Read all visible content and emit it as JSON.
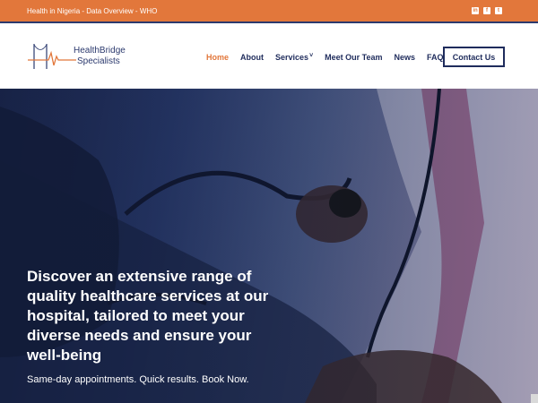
{
  "topbar": {
    "link_text": "Health in Nigeria - Data Overview - WHO",
    "socials": [
      {
        "icon": "linkedin-icon",
        "glyph": "in"
      },
      {
        "icon": "facebook-icon",
        "glyph": "f"
      },
      {
        "icon": "twitter-icon",
        "glyph": "t"
      }
    ]
  },
  "brand": {
    "line1": "HealthBridge",
    "line2": "Specialists"
  },
  "nav": {
    "items": [
      {
        "label": "Home",
        "active": true
      },
      {
        "label": "About"
      },
      {
        "label": "Services",
        "has_dropdown": true
      },
      {
        "label": "Meet Our Team"
      },
      {
        "label": "News"
      },
      {
        "label": "FAQ"
      }
    ],
    "dropdown_glyph": "˅",
    "contact_label": "Contact Us"
  },
  "hero": {
    "title": "Discover an extensive range of quality healthcare services at our hospital, tailored to meet your diverse needs and ensure your well-being",
    "subtitle": "Same-day appointments. Quick results. Book Now."
  },
  "colors": {
    "accent": "#e2773b",
    "navy": "#1f2c5c"
  }
}
